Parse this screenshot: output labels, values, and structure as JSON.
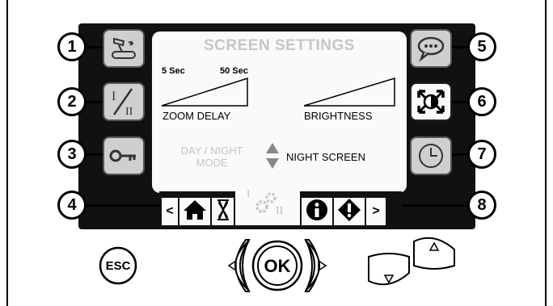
{
  "callouts": [
    "1",
    "2",
    "3",
    "4",
    "5",
    "6",
    "7",
    "8"
  ],
  "screen": {
    "title": "SCREEN SETTINGS",
    "zoom_delay": {
      "min_label": "5 Sec",
      "max_label": "50 Sec",
      "caption": "ZOOM DELAY"
    },
    "brightness": {
      "caption": "BRIGHTNESS"
    },
    "day_night": {
      "label_line1": "DAY / NIGHT",
      "label_line2": "MODE",
      "value": "NIGHT SCREEN"
    }
  },
  "nav": {
    "prev": "<",
    "next": ">",
    "cog_roman_1": "I",
    "cog_roman_2": "II"
  },
  "hardware": {
    "esc_label": "ESC",
    "ok_label": "OK"
  },
  "icons": {
    "btn1": "joystick-icon",
    "btn2": "drive-mode-switch-icon",
    "btn3": "key-icon",
    "btn5": "speech-bubble-icon",
    "btn6": "contrast-icon",
    "btn7": "clock-icon",
    "home": "home-icon",
    "hourglass": "hourglass-icon",
    "info": "info-icon",
    "warning": "warning-icon"
  }
}
